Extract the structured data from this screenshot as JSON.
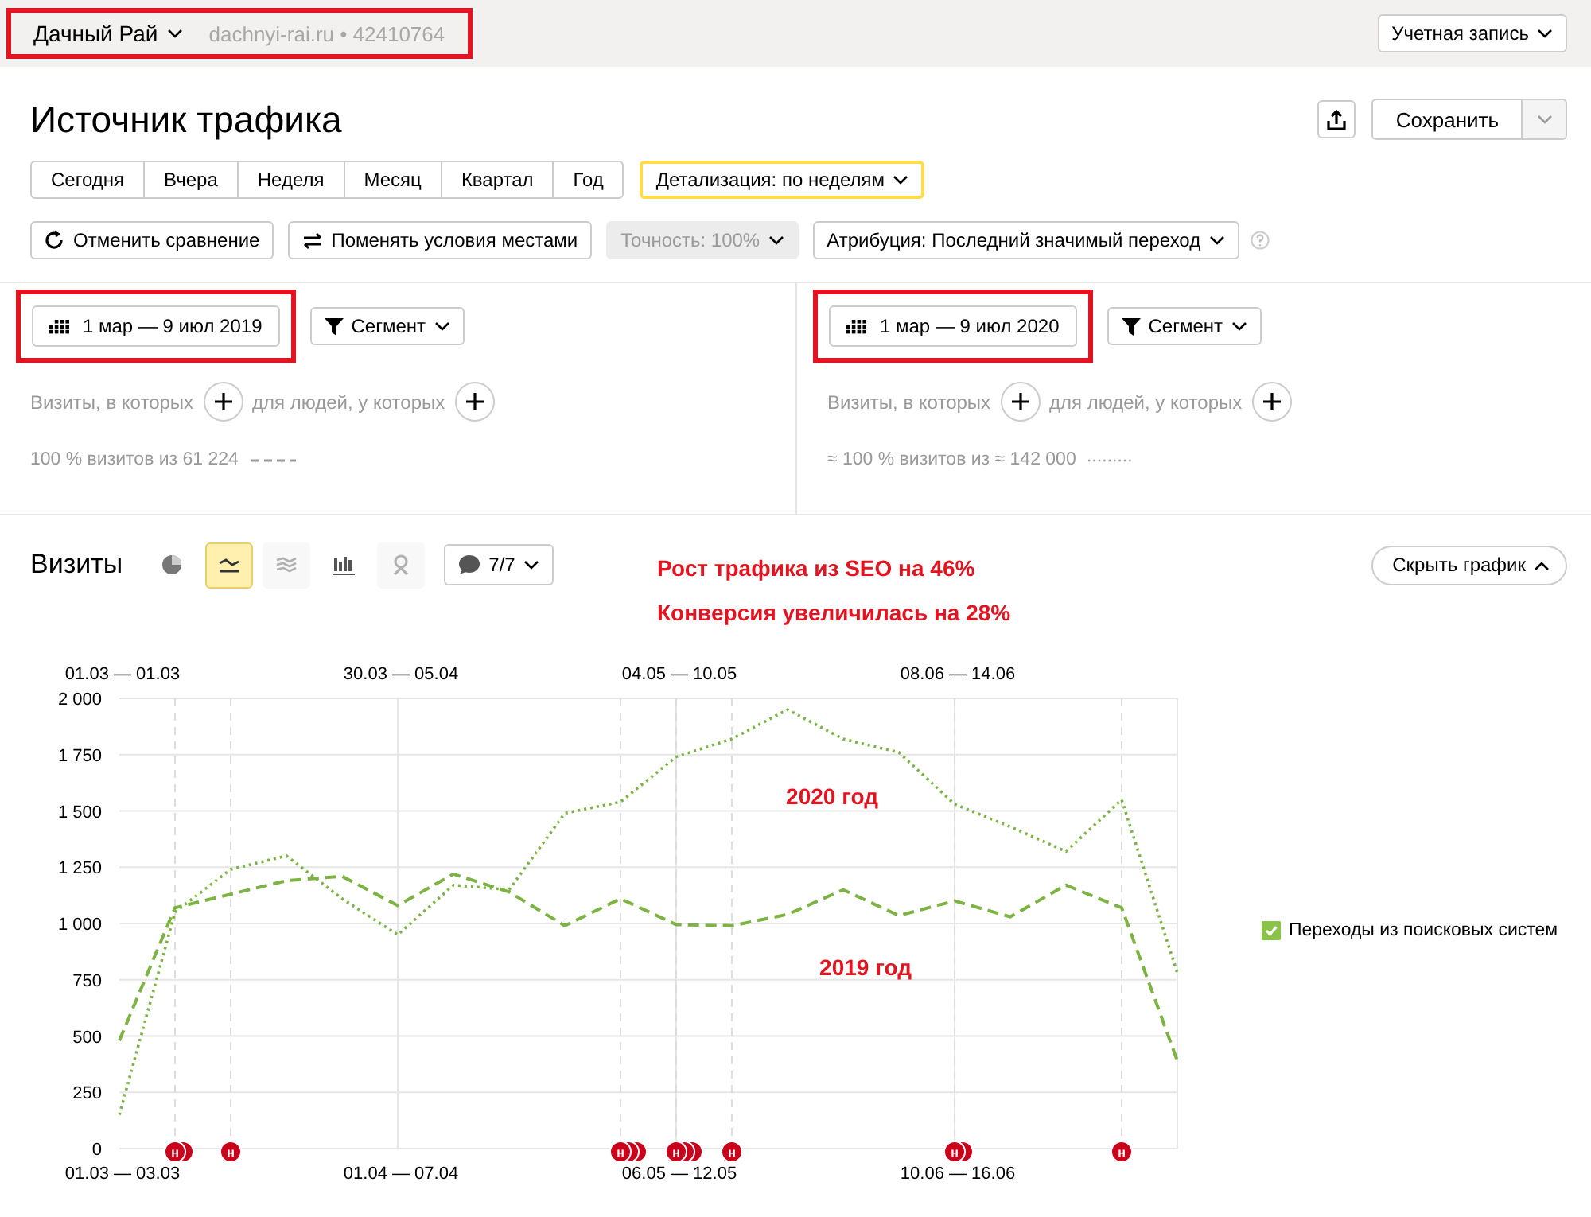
{
  "account": {
    "name": "Дачный Рай",
    "site": "dachnyi-rai.ru",
    "separator": "•",
    "counter_id": "42410764",
    "highlighted": true
  },
  "account_button": "Учетная запись",
  "title": "Источник трафика",
  "save_button": "Сохранить",
  "periods": [
    {
      "label": "Сегодня",
      "selected": false
    },
    {
      "label": "Вчера",
      "selected": false
    },
    {
      "label": "Неделя",
      "selected": false
    },
    {
      "label": "Месяц",
      "selected": false
    },
    {
      "label": "Квартал",
      "selected": false
    },
    {
      "label": "Год",
      "selected": false
    }
  ],
  "detail_button": "Детализация: по неделям",
  "actions": [
    {
      "label": "Отменить сравнение",
      "kind": "undo",
      "disabled": false
    },
    {
      "label": "Поменять условия местами",
      "kind": "swap",
      "disabled": false
    },
    {
      "label": "Точность: 100%",
      "kind": "dropdown",
      "disabled": true
    },
    {
      "label": "Атрибуция: Последний значимый переход",
      "kind": "dropdown",
      "disabled": false
    }
  ],
  "segments": [
    {
      "date_range": "1 мар — 9 июл 2019",
      "highlighted": true,
      "segment_button": "Сегмент",
      "visits_condition": "Визиты, в которых",
      "people_condition": "для людей, у которых",
      "summary": "100 % визитов из 61 224"
    },
    {
      "date_range": "1 мар — 9 июл 2020",
      "highlighted": true,
      "segment_button": "Сегмент",
      "visits_condition": "Визиты, в которых",
      "people_condition": "для людей, у которых",
      "summary": "≈ 100 % визитов из ≈ 142 000"
    }
  ],
  "chart_panel": {
    "title": "Визиты",
    "views": [
      {
        "kind": "pie",
        "selected": false,
        "disabled": false
      },
      {
        "kind": "line",
        "selected": true,
        "disabled": false
      },
      {
        "kind": "area",
        "selected": false,
        "disabled": true
      },
      {
        "kind": "bars",
        "selected": false,
        "disabled": false
      },
      {
        "kind": "map",
        "selected": false,
        "disabled": true
      }
    ],
    "notes_button": "7/7",
    "callouts": [
      "Рост трафика из SEO на 46%",
      "Конверсия увеличилась на 28%"
    ],
    "hide_button": "Скрыть график",
    "top_axis_labels": [
      "01.03 — 01.03",
      "30.03 — 05.04",
      "04.05 — 10.05",
      "08.06 — 14.06"
    ],
    "event_markers": [
      {
        "label": "н",
        "kind": "double"
      },
      {
        "label": "н",
        "kind": "single"
      },
      {
        "label": "н",
        "kind": "triple"
      },
      {
        "label": "н",
        "kind": "triple"
      },
      {
        "label": "н",
        "kind": "single"
      },
      {
        "label": "н",
        "kind": "double"
      },
      {
        "label": "н",
        "kind": "single"
      }
    ],
    "chart_data": {
      "type": "line",
      "categories": [
        "01.03 — 03.03",
        null,
        null,
        null,
        null,
        "01.04 — 07.04",
        null,
        null,
        null,
        null,
        "06.05 — 12.05",
        null,
        null,
        null,
        null,
        "10.06 — 16.06",
        null,
        null,
        null,
        null
      ],
      "ylim": [
        0,
        2000
      ],
      "grid": true,
      "yticks": [
        {
          "value": 0,
          "label": "0"
        },
        {
          "value": 250,
          "label": "250"
        },
        {
          "value": 500,
          "label": "500"
        },
        {
          "value": 750,
          "label": "750"
        },
        {
          "value": 1000,
          "label": "1 000"
        },
        {
          "value": 1250,
          "label": "1 250"
        },
        {
          "value": 1500,
          "label": "1 500"
        },
        {
          "value": 1750,
          "label": "1 750"
        },
        {
          "value": 2000,
          "label": "2 000"
        }
      ],
      "series": [
        {
          "color": "#7cb342",
          "line_style": "dashed",
          "values": [
            480,
            1070,
            1130,
            1190,
            1210,
            1080,
            1220,
            1140,
            990,
            1110,
            995,
            990,
            1040,
            1150,
            1035,
            1100,
            1030,
            1170,
            1070,
            390
          ]
        },
        {
          "color": "#7cb342",
          "line_style": "dotted",
          "values": [
            150,
            1050,
            1240,
            1300,
            1110,
            950,
            1170,
            1150,
            1490,
            1540,
            1740,
            1820,
            1950,
            1820,
            1760,
            1530,
            1430,
            1320,
            1550,
            780
          ]
        }
      ],
      "annotations": [
        "2020 год",
        "2019 год"
      ]
    },
    "legend": [
      {
        "label": "Переходы из поисковых систем",
        "checked": true,
        "color": "#8bc34a"
      }
    ]
  }
}
